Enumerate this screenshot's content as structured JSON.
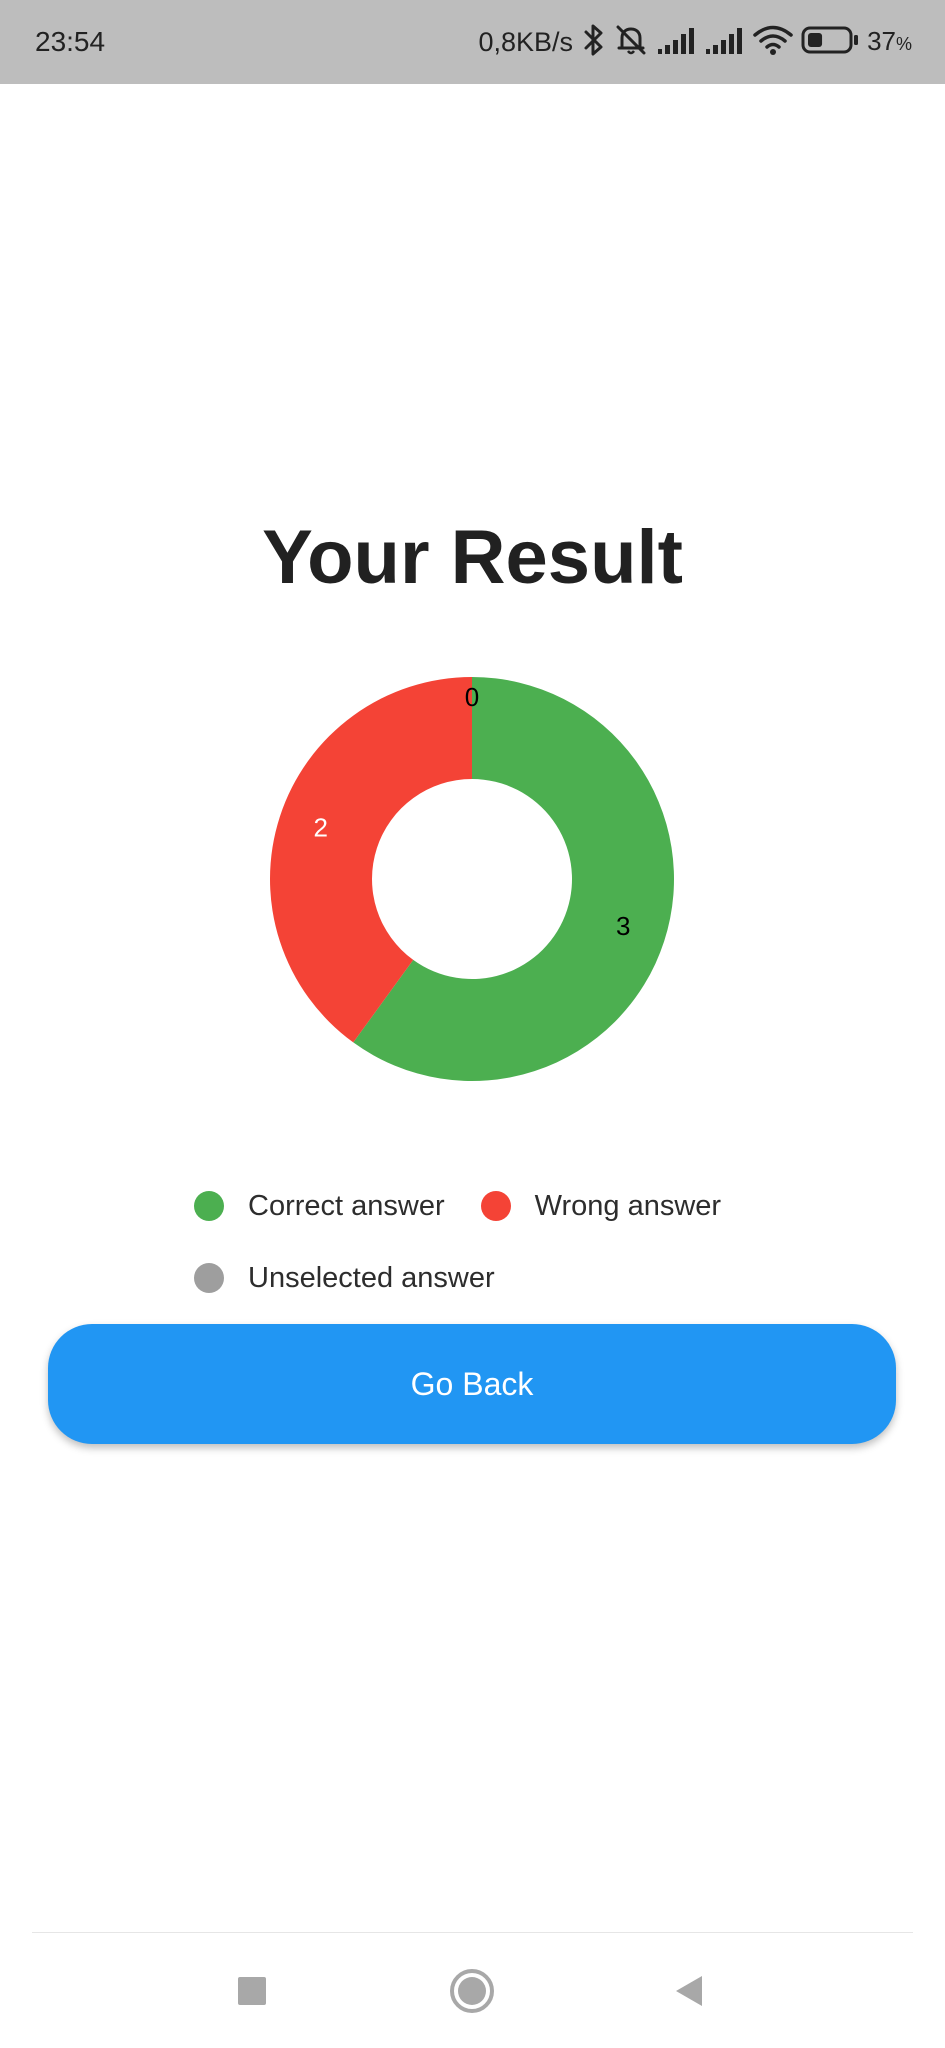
{
  "status_bar": {
    "time": "23:54",
    "net_speed": "0,8KB/s",
    "battery_percent": "37",
    "battery_percent_sign": "%",
    "battery_level": 0.37,
    "icons": [
      "bluetooth-icon",
      "mute-icon",
      "signal-icon",
      "signal-icon",
      "wifi-icon",
      "battery-icon"
    ]
  },
  "page": {
    "title": "Your Result"
  },
  "chart_data": {
    "type": "pie",
    "variant": "donut",
    "categories": [
      "Correct answer",
      "Wrong answer",
      "Unselected answer"
    ],
    "values": [
      3,
      2,
      0
    ],
    "labels": [
      "3",
      "2",
      "0"
    ],
    "colors": [
      "#4caf50",
      "#f44336",
      "#9e9e9e"
    ],
    "label_colors": [
      "#000000",
      "#ffffff",
      "#000000"
    ],
    "legend_position": "bottom"
  },
  "legend": {
    "items": [
      {
        "label": "Correct answer",
        "color": "#4caf50"
      },
      {
        "label": "Wrong answer",
        "color": "#f44336"
      },
      {
        "label": "Unselected answer",
        "color": "#9e9e9e"
      }
    ]
  },
  "actions": {
    "go_back_label": "Go Back"
  },
  "colors": {
    "status_bar_bg": "#bdbdbd",
    "primary": "#2196f3",
    "title_text": "#212121",
    "nav_icon": "#a8a8a8"
  },
  "nav_bar": {
    "icons": [
      "recents-icon",
      "home-icon",
      "back-icon"
    ]
  }
}
